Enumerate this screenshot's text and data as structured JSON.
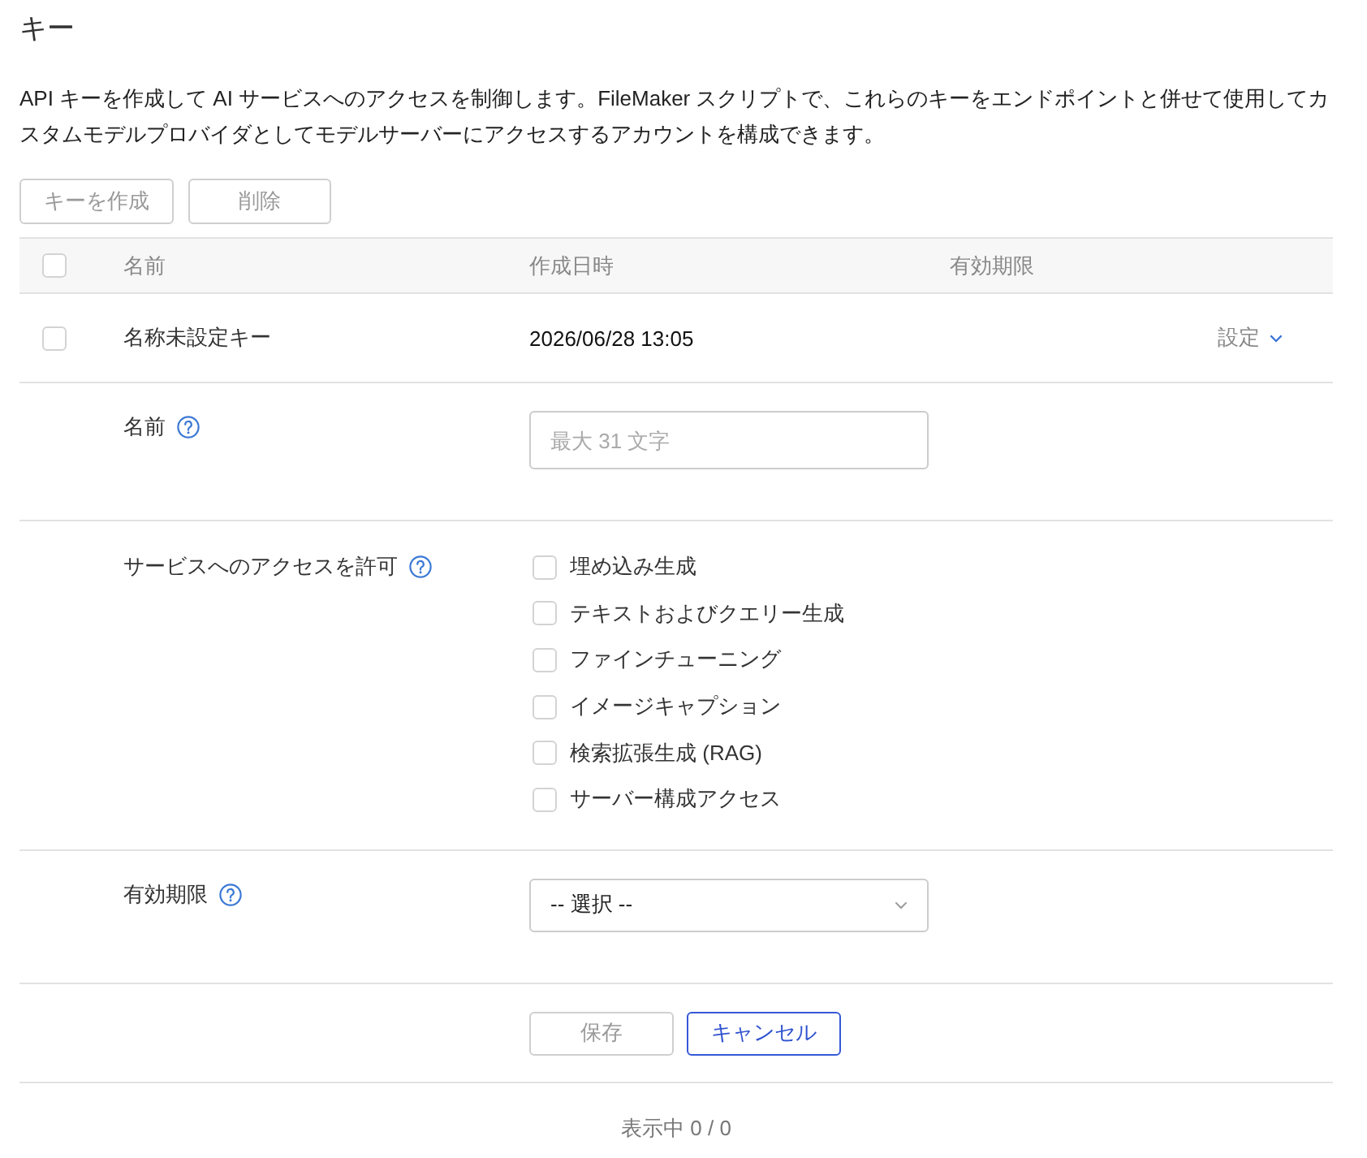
{
  "page": {
    "title": "キー",
    "description": "API キーを作成して AI サービスへのアクセスを制御します。FileMaker スクリプトで、これらのキーをエンドポイントと併せて使用してカスタムモデルプロバイダとしてモデルサーバーにアクセスするアカウントを構成できます。"
  },
  "toolbar": {
    "buttons": [
      {
        "label": "キーを作成",
        "disabled": true
      },
      {
        "label": "削除",
        "disabled": true
      }
    ]
  },
  "table": {
    "header_checkbox": {
      "checked": false
    },
    "columns": [
      "名前",
      "作成日時",
      "有効期限"
    ],
    "rows": [
      {
        "checked": false,
        "name": "名称未設定キー",
        "created": "2026/06/28 13:05",
        "action": "設定",
        "expanded": true,
        "details": {
          "fields": [
            {
              "kind": "text",
              "label": "名前",
              "placeholder": "最大 31 文字"
            },
            {
              "kind": "checkboxes",
              "label": "サービスへのアクセスを許可",
              "options": [
                {
                  "label": "埋め込み生成",
                  "checked": false
                },
                {
                  "label": "テキストおよびクエリー生成",
                  "checked": false
                },
                {
                  "label": "ファインチューニング",
                  "checked": false
                },
                {
                  "label": "イメージキャプション",
                  "checked": false
                },
                {
                  "label": "検索拡張生成 (RAG)",
                  "checked": false
                },
                {
                  "label": "サーバー構成アクセス",
                  "checked": false
                }
              ]
            },
            {
              "kind": "select",
              "label": "有効期限",
              "value": "-- 選択 --"
            }
          ],
          "buttons": [
            {
              "label": "保存",
              "disabled": true
            },
            {
              "label": "キャンセル",
              "disabled": false
            }
          ]
        }
      }
    ]
  },
  "footer": {
    "status": "表示中 0 / 0"
  }
}
